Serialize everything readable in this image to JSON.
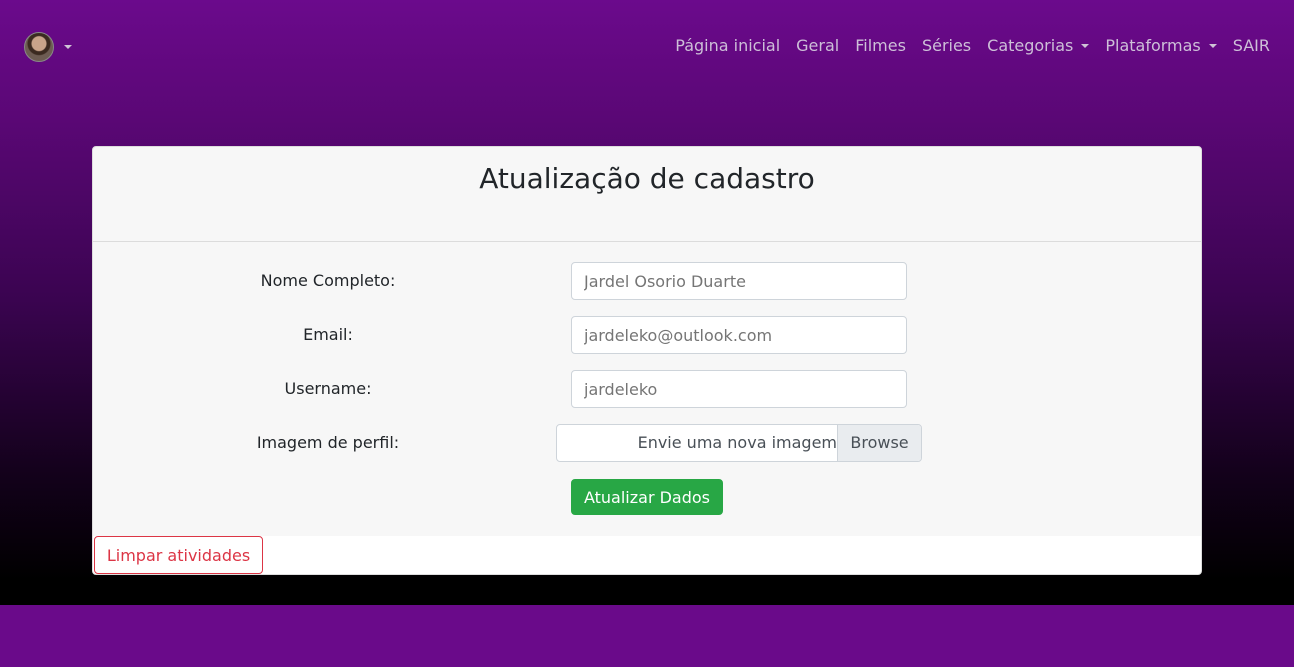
{
  "navbar": {
    "links": {
      "home": "Página inicial",
      "geral": "Geral",
      "filmes": "Filmes",
      "series": "Séries",
      "categorias": "Categorias",
      "plataformas": "Plataformas",
      "sair": "SAIR"
    }
  },
  "card": {
    "title": "Atualização de cadastro",
    "fields": {
      "name": {
        "label": "Nome Completo:",
        "placeholder": "Jardel Osorio Duarte"
      },
      "email": {
        "label": "Email:",
        "placeholder": "jardeleko@outlook.com"
      },
      "username": {
        "label": "Username:",
        "placeholder": "jardeleko"
      },
      "image": {
        "label": "Imagem de perfil:",
        "file_text": "Envie uma nova imagem",
        "browse_label": "Browse"
      }
    },
    "submit_label": "Atualizar Dados",
    "clear_label": "Limpar atividades"
  }
}
